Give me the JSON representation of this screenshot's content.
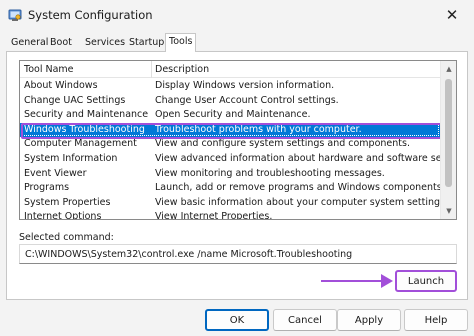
{
  "window": {
    "title": "System Configuration",
    "close_glyph": "✕"
  },
  "tabs": [
    {
      "label": "General"
    },
    {
      "label": "Boot"
    },
    {
      "label": "Services"
    },
    {
      "label": "Startup"
    },
    {
      "label": "Tools",
      "active": true
    }
  ],
  "tools_list": {
    "headers": {
      "name": "Tool Name",
      "description": "Description"
    },
    "rows": [
      {
        "name": "About Windows",
        "description": "Display Windows version information."
      },
      {
        "name": "Change UAC Settings",
        "description": "Change User Account Control settings."
      },
      {
        "name": "Security and Maintenance",
        "description": "Open Security and Maintenance."
      },
      {
        "name": "Windows Troubleshooting",
        "description": "Troubleshoot problems with your computer.",
        "selected": true
      },
      {
        "name": "Computer Management",
        "description": "View and configure system settings and components."
      },
      {
        "name": "System Information",
        "description": "View advanced information about hardware and software settings."
      },
      {
        "name": "Event Viewer",
        "description": "View monitoring and troubleshooting messages."
      },
      {
        "name": "Programs",
        "description": "Launch, add or remove programs and Windows components."
      },
      {
        "name": "System Properties",
        "description": "View basic information about your computer system settings."
      },
      {
        "name": "Internet Options",
        "description": "View Internet Properties."
      }
    ]
  },
  "selected_command": {
    "label": "Selected command:",
    "value": "C:\\WINDOWS\\System32\\control.exe /name Microsoft.Troubleshooting"
  },
  "launch_label": "Launch",
  "buttons": {
    "ok": "OK",
    "cancel": "Cancel",
    "apply": "Apply",
    "help": "Help"
  },
  "colors": {
    "selection": "#0078d7",
    "annotation": "#a24fd9",
    "default_button_border": "#0067c0"
  },
  "icons": {
    "app": "system-configuration-icon",
    "close": "close-icon",
    "scroll_up": "scroll-up-icon",
    "scroll_down": "scroll-down-icon",
    "annotation_arrow": "arrow-icon"
  }
}
